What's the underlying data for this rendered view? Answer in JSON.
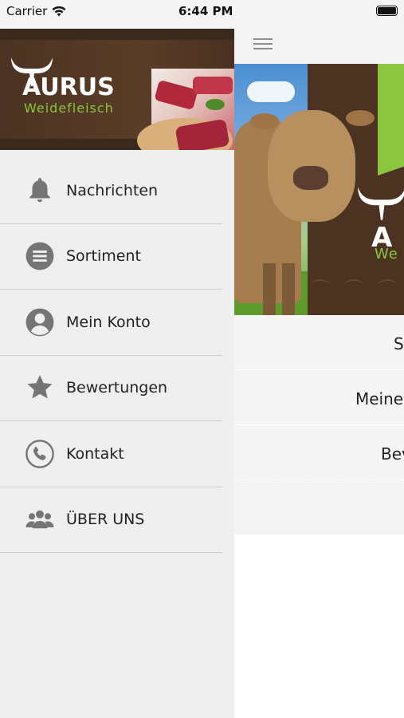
{
  "status_bar": {
    "carrier": "Carrier",
    "time": "6:44 PM",
    "icons": [
      "wifi-icon",
      "battery-icon"
    ]
  },
  "drawer": {
    "brand": {
      "name": "AURUS",
      "subtitle": "Weidefleisch"
    },
    "items": [
      {
        "label": "Nachrichten",
        "icon": "bell-icon"
      },
      {
        "label": "Sortiment",
        "icon": "list-icon"
      },
      {
        "label": "Mein Konto",
        "icon": "user-icon"
      },
      {
        "label": "Bewertungen",
        "icon": "star-icon"
      },
      {
        "label": "Kontakt",
        "icon": "phone-icon"
      },
      {
        "label": "ÜBER UNS",
        "icon": "group-icon"
      }
    ]
  },
  "main": {
    "menu_icon": "hamburger-icon",
    "hero": {
      "brand_fragment": "A",
      "subtitle_fragment": "We"
    },
    "rows": [
      {
        "label": "S"
      },
      {
        "label": "Meine"
      },
      {
        "label": "Bev"
      },
      {
        "label": ""
      }
    ]
  },
  "colors": {
    "brand_brown": "#4b3221",
    "brand_green": "#8cc63f",
    "drawer_bg": "#efefef",
    "icon_gray": "#7a7a7a"
  }
}
